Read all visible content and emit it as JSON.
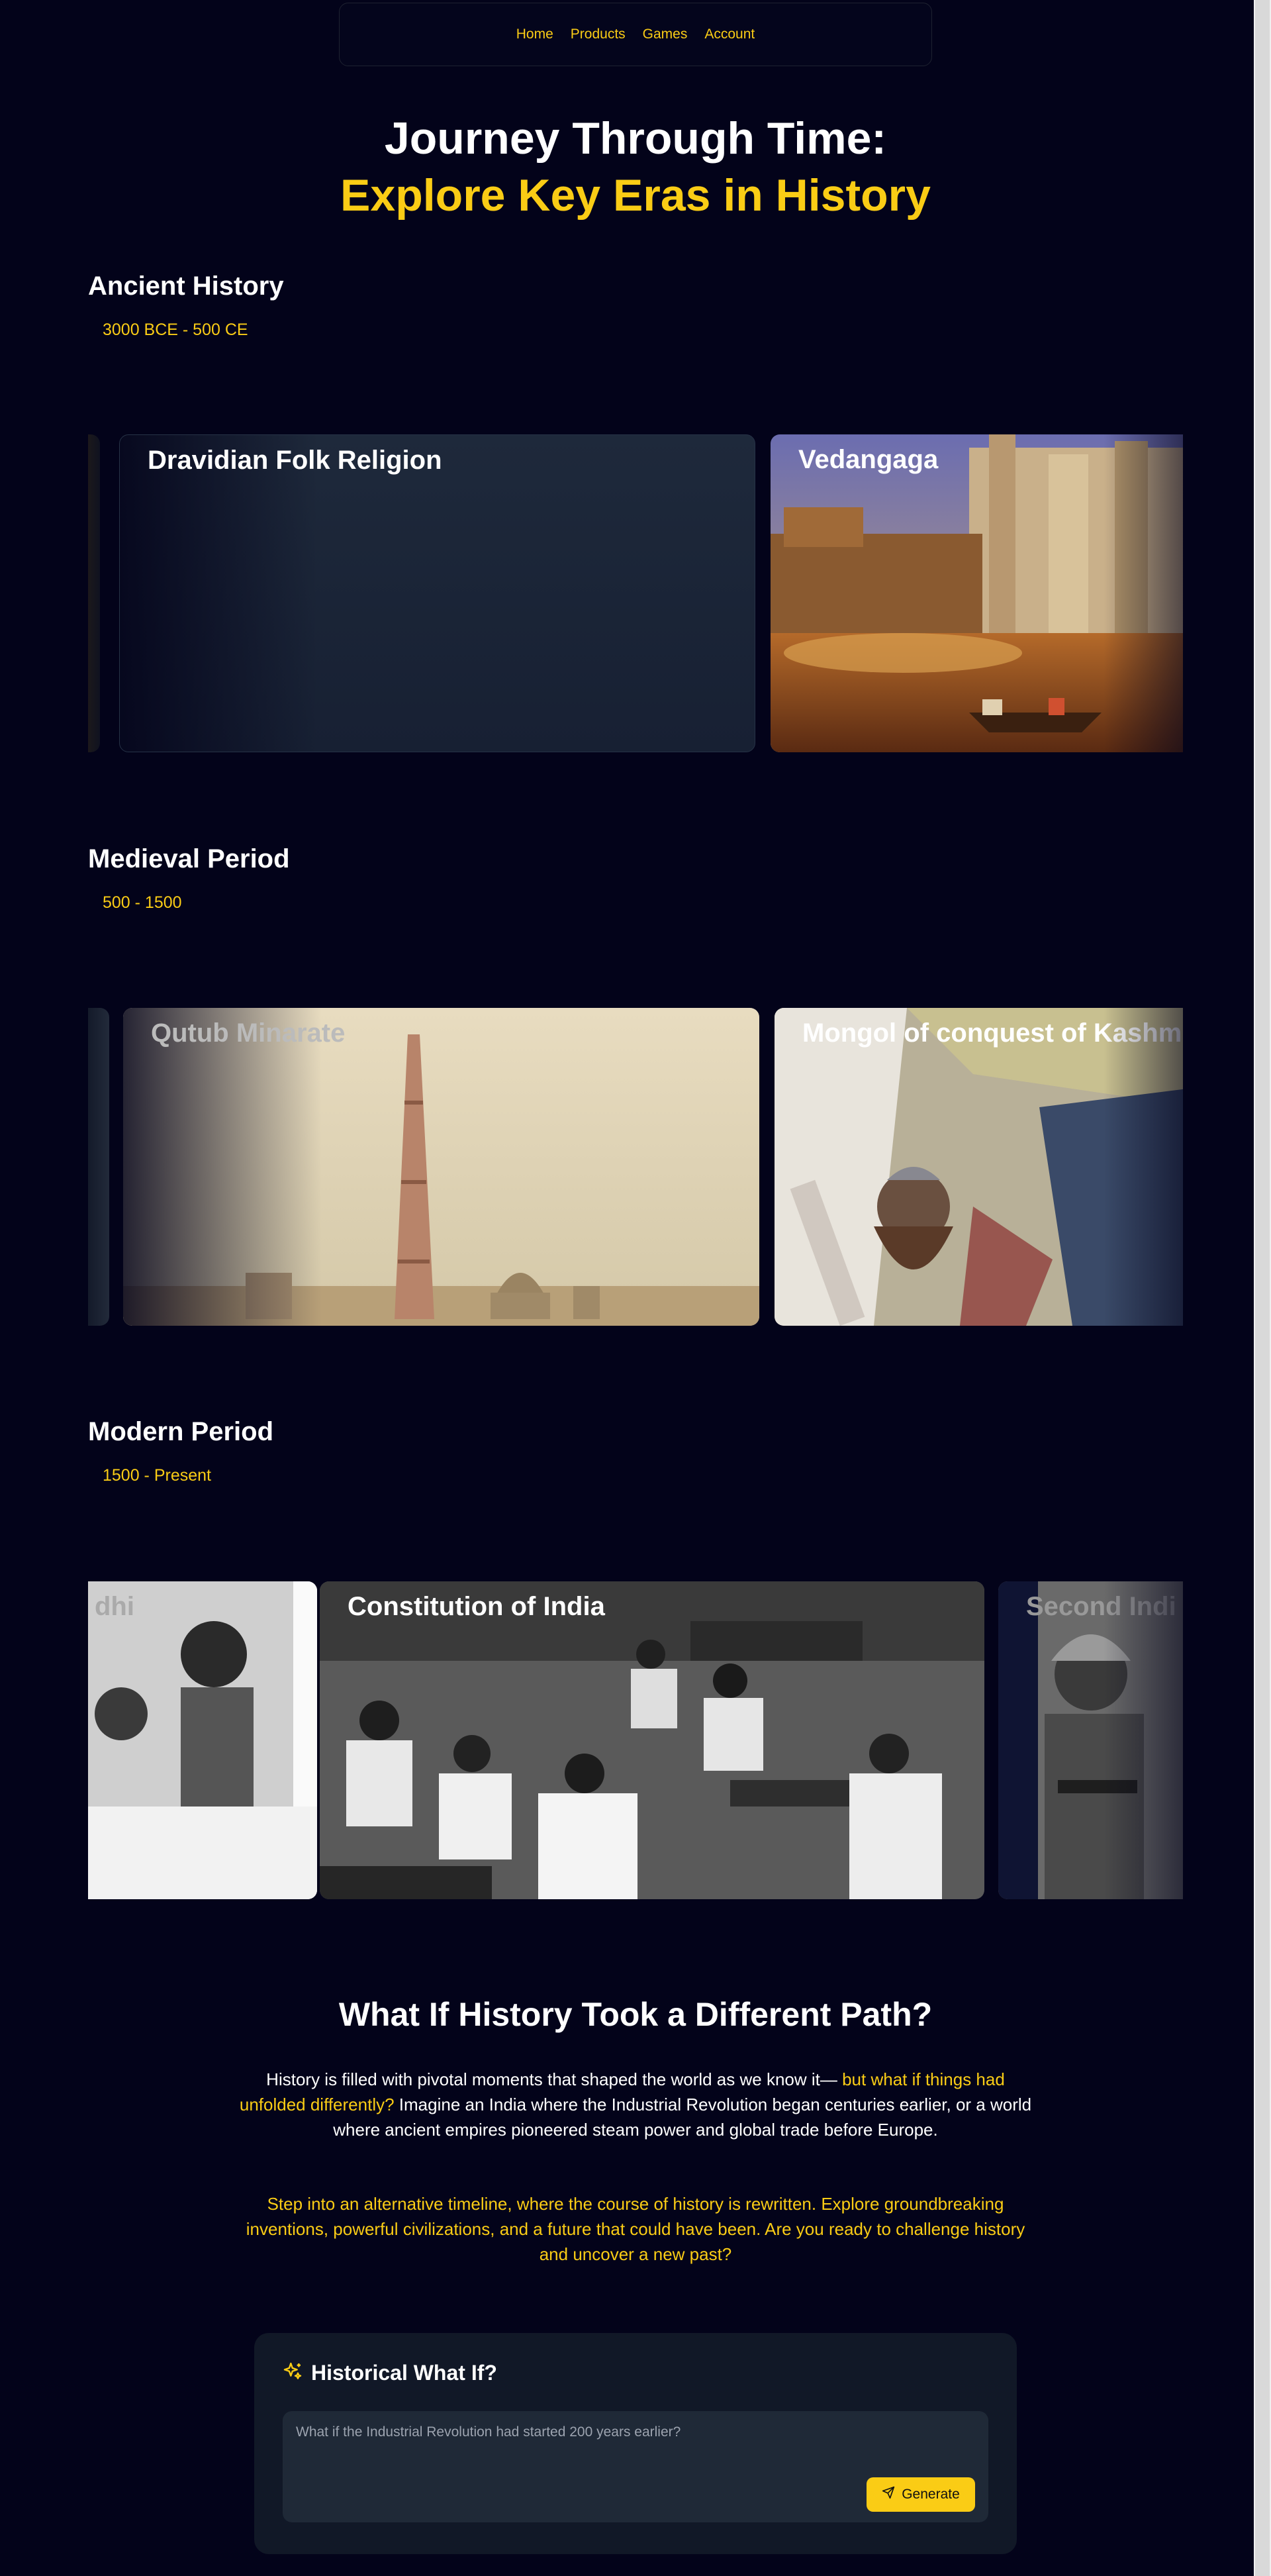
{
  "nav": {
    "items": [
      "Home",
      "Products",
      "Games",
      "Account"
    ]
  },
  "hero": {
    "line1": "Journey Through Time:",
    "line2": "Explore Key Eras in History"
  },
  "eras": [
    {
      "title": "Ancient History",
      "range": "3000 BCE - 500 CE",
      "cards": [
        "Dravidian Folk Religion",
        "Vedangaga"
      ]
    },
    {
      "title": "Medieval Period",
      "range": "500 - 1500",
      "cards": [
        "Qutub Minarate",
        "Mongol of conquest of Kashmi"
      ]
    },
    {
      "title": "Modern Period",
      "range": "1500 - Present",
      "cards": [
        "dhi",
        "Constitution of India",
        "Second Indi"
      ]
    }
  ],
  "whatif": {
    "heading": "What If History Took a Different Path?",
    "p1_a": "History is filled with pivotal moments that shaped the world as we know it— ",
    "p1_b": "but what if things had unfolded differently?",
    "p1_c": " Imagine an India where the Industrial Revolution began centuries earlier, or a world where ancient empires pioneered steam power and global trade before Europe.",
    "p2": "Step into an alternative timeline, where the course of history is rewritten. Explore groundbreaking inventions, powerful civilizations, and a future that could have been. Are you ready to challenge history and uncover a new past?"
  },
  "ai": {
    "title": "Historical What If?",
    "placeholder": "What if the Industrial Revolution had started 200 years earlier?",
    "button": "Generate",
    "icons": {
      "title": "sparkles-icon",
      "button": "send-icon"
    }
  },
  "colors": {
    "background": "#03031a",
    "accent": "#facc15",
    "panel": "#111827",
    "input": "#1f2937"
  }
}
